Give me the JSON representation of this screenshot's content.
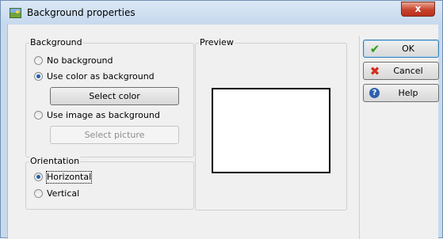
{
  "window": {
    "title": "Background properties",
    "close_glyph": "x",
    "app_icon": "picture-icon"
  },
  "background_group": {
    "title": "Background",
    "options": [
      {
        "label": "No background",
        "checked": false
      },
      {
        "label": "Use color as background",
        "checked": true
      },
      {
        "label": "Use image as background",
        "checked": false
      }
    ],
    "select_color_label": "Select color",
    "select_picture_label": "Select picture"
  },
  "orientation_group": {
    "title": "Orientation",
    "options": [
      {
        "label": "Horizontal",
        "checked": true
      },
      {
        "label": "Vertical",
        "checked": false
      }
    ]
  },
  "preview_group": {
    "title": "Preview",
    "preview_color": "#ffffff"
  },
  "buttons": {
    "ok": {
      "label": "OK",
      "icon": "check-icon",
      "icon_glyph": "✔"
    },
    "cancel": {
      "label": "Cancel",
      "icon": "cross-icon",
      "icon_glyph": "✖"
    },
    "help": {
      "label": "Help",
      "icon": "help-icon",
      "icon_glyph": "?"
    }
  },
  "colors": {
    "ok_icon": "#2f9a1e",
    "cancel_icon": "#d42a1e",
    "help_icon": "#2e5fae"
  }
}
